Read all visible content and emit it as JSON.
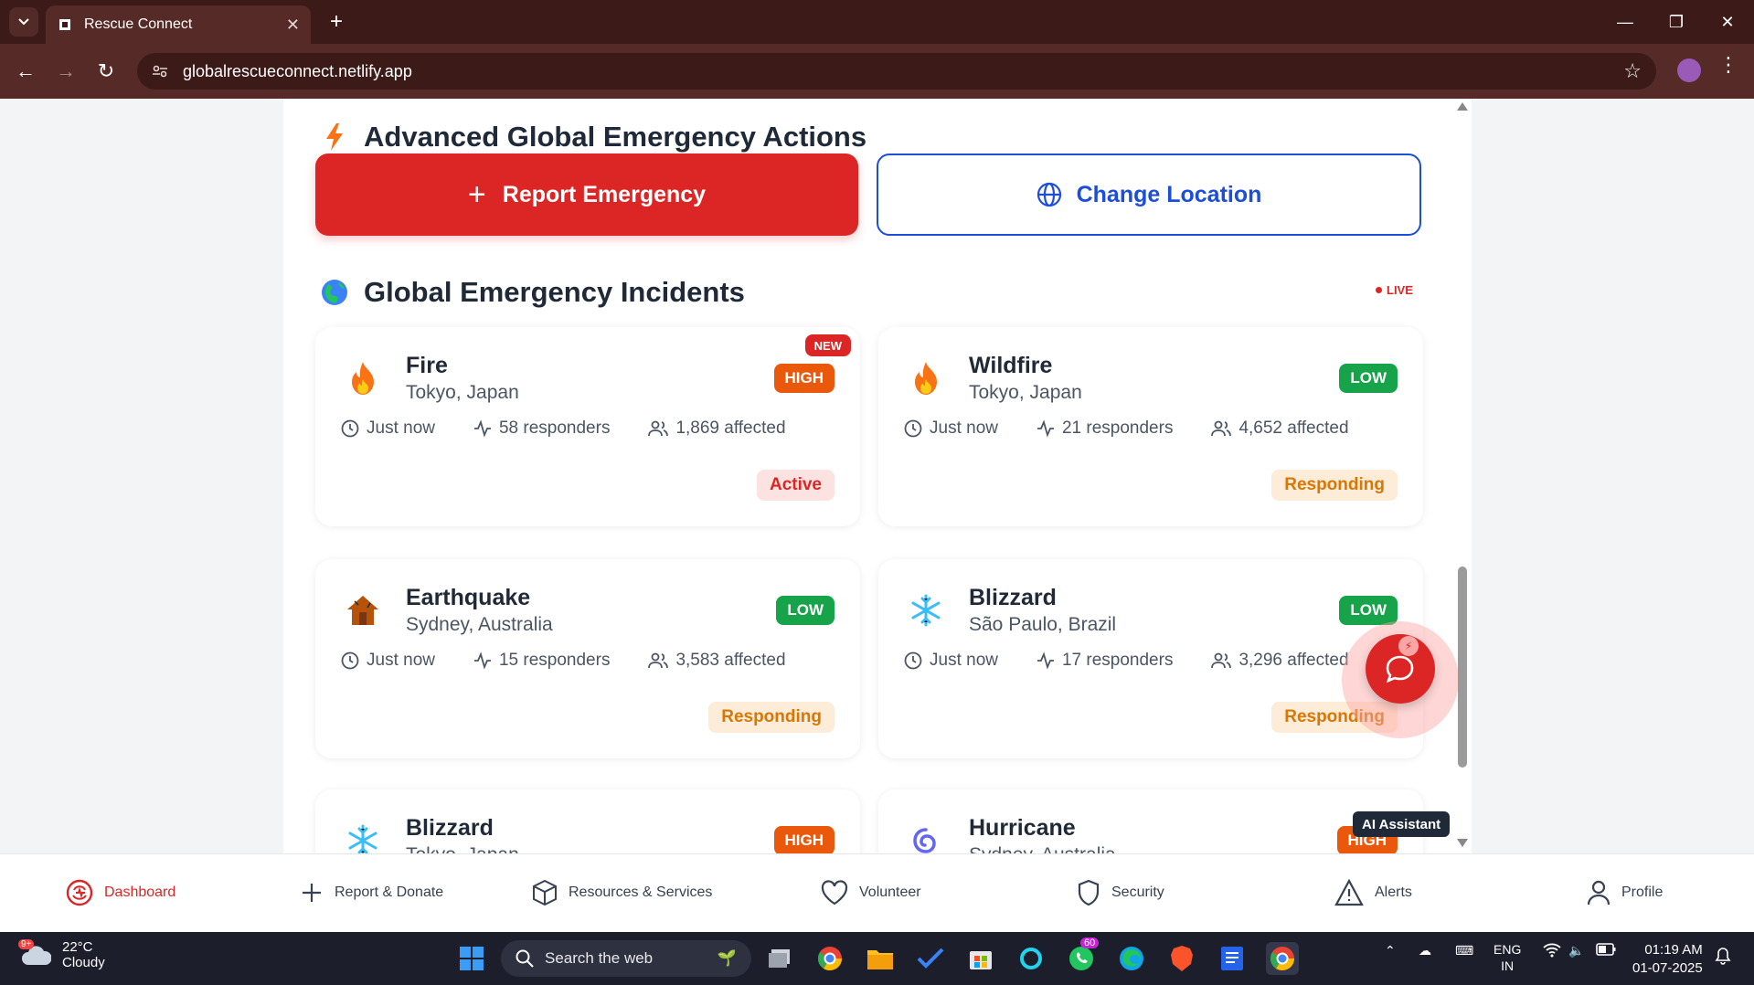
{
  "browser": {
    "tab_title": "Rescue Connect",
    "url": "globalrescueconnect.netlify.app"
  },
  "actions": {
    "heading": "Advanced Global Emergency Actions",
    "report_label": "Report Emergency",
    "location_label": "Change Location"
  },
  "incidents": {
    "heading": "Global Emergency Incidents",
    "live_label": "LIVE",
    "cards": [
      {
        "title": "Fire",
        "location": "Tokyo, Japan",
        "severity": "HIGH",
        "new_badge": "NEW",
        "time": "Just now",
        "responders": "58 responders",
        "affected": "1,869 affected",
        "status": "Active"
      },
      {
        "title": "Wildfire",
        "location": "Tokyo, Japan",
        "severity": "LOW",
        "time": "Just now",
        "responders": "21 responders",
        "affected": "4,652 affected",
        "status": "Responding"
      },
      {
        "title": "Earthquake",
        "location": "Sydney, Australia",
        "severity": "LOW",
        "time": "Just now",
        "responders": "15 responders",
        "affected": "3,583 affected",
        "status": "Responding"
      },
      {
        "title": "Blizzard",
        "location": "São Paulo, Brazil",
        "severity": "LOW",
        "time": "Just now",
        "responders": "17 responders",
        "affected": "3,296 affected",
        "status": "Responding"
      },
      {
        "title": "Blizzard",
        "location": "Tokyo, Japan",
        "severity": "HIGH"
      },
      {
        "title": "Hurricane",
        "location": "Sydney, Australia",
        "severity": "HIGH"
      }
    ]
  },
  "ai_assistant": {
    "label": "AI Assistant"
  },
  "bottom_nav": {
    "items": [
      {
        "label": "Dashboard",
        "icon": "shield-pulse-icon"
      },
      {
        "label": "Report & Donate",
        "icon": "plus-icon"
      },
      {
        "label": "Resources & Services",
        "icon": "package-icon"
      },
      {
        "label": "Volunteer",
        "icon": "heart-icon"
      },
      {
        "label": "Security",
        "icon": "shield-icon"
      },
      {
        "label": "Alerts",
        "icon": "alert-triangle-icon"
      },
      {
        "label": "Profile",
        "icon": "user-icon"
      }
    ]
  },
  "taskbar": {
    "temperature": "22°C",
    "weather": "Cloudy",
    "weather_badge": "9+",
    "search_placeholder": "Search the web",
    "whatsapp_badge": "60",
    "lang_top": "ENG",
    "lang_bottom": "IN",
    "time": "01:19 AM",
    "date": "01-07-2025"
  },
  "colors": {
    "primary_red": "#dc2626",
    "accent_blue": "#1d4ed8",
    "high": "#ea580c",
    "low": "#16a34a"
  }
}
